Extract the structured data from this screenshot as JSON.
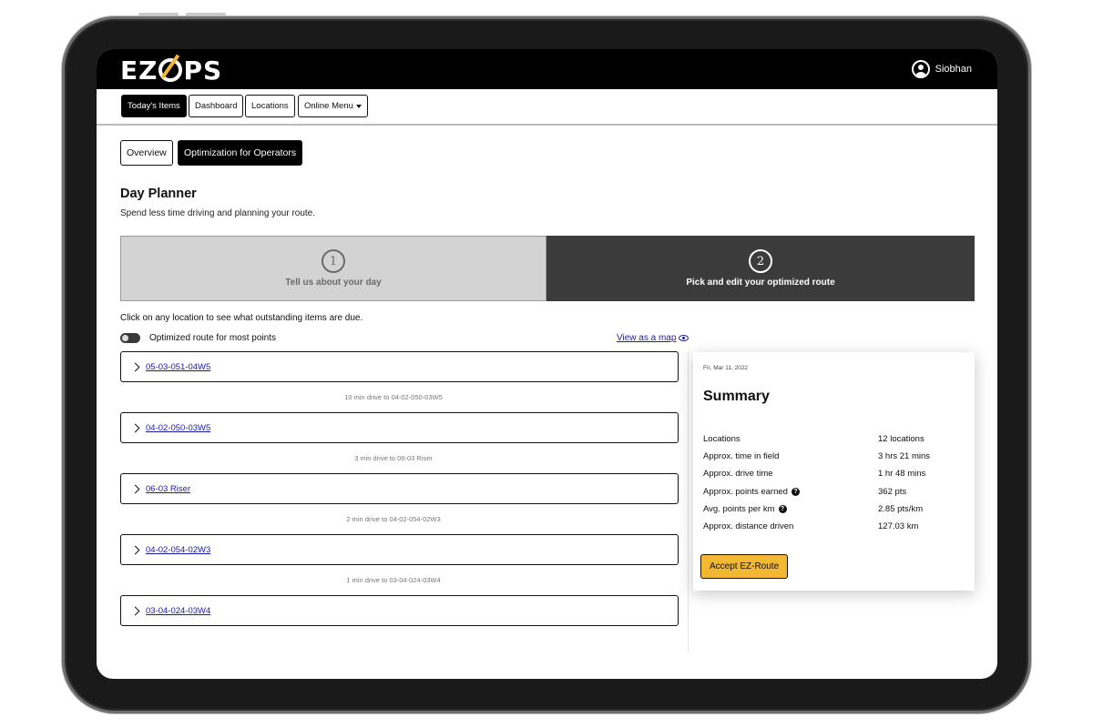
{
  "app": {
    "logo_text": "EZOPS",
    "brand_accent": "#f2b733"
  },
  "user": {
    "name": "Siobhan"
  },
  "nav": {
    "items": [
      {
        "label": "Today's Items"
      },
      {
        "label": "Dashboard"
      },
      {
        "label": "Locations"
      },
      {
        "label": "Online Menu"
      }
    ]
  },
  "subtabs": [
    {
      "label": "Overview"
    },
    {
      "label": "Optimization for Operators"
    }
  ],
  "page": {
    "title": "Day Planner",
    "subtitle": "Spend less time driving and planning your route."
  },
  "steps": [
    {
      "number": "1",
      "label": "Tell us about your day"
    },
    {
      "number": "2",
      "label": "Pick and edit your optimized route"
    }
  ],
  "instructions": "Click on any location to see what outstanding items are due.",
  "toggle": {
    "label": "Optimized route for most points"
  },
  "map_link": "View as a map",
  "route": {
    "items": [
      {
        "location": "05-03-051-04W5"
      },
      {
        "location": "04-02-050-03W5"
      },
      {
        "location": "06-03 Riser"
      },
      {
        "location": "04-02-054-02W3"
      },
      {
        "location": "03-04-024-03W4"
      }
    ],
    "drives": [
      "10 min drive to 04-02-050-03W5",
      "3 min drive to 06-03 Riser",
      "2 min drive to 04-02-054-02W3",
      "1 min drive to 03-04-024-03W4"
    ]
  },
  "summary": {
    "date": "Fri, Mar 11, 2022",
    "title": "Summary",
    "rows": [
      {
        "label": "Locations",
        "value": "12 locations"
      },
      {
        "label": "Approx. time in field",
        "value": "3 hrs 21 mins"
      },
      {
        "label": "Approx. drive time",
        "value": "1 hr 48 mins"
      },
      {
        "label": "Approx. points earned",
        "value": "362 pts",
        "help": "?"
      },
      {
        "label": "Avg. points per km",
        "value": "2.85 pts/km",
        "help": "?"
      },
      {
        "label": "Approx. distance driven",
        "value": "127.03 km"
      }
    ],
    "accept_label": "Accept EZ-Route"
  }
}
